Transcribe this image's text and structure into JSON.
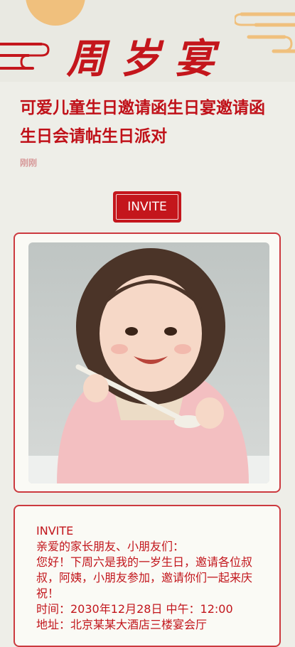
{
  "header": {
    "brand": "周岁宴"
  },
  "article": {
    "title": "可爱儿童生日邀请函生日宴邀请函生日会请帖生日派对",
    "time": "刚刚"
  },
  "badge": {
    "label": "INVITE"
  },
  "invitation": {
    "heading": "INVITE",
    "greeting": "亲爱的家长朋友、小朋友们：",
    "message": "您好！下周六是我的一岁生日，邀请各位叔叔，阿姨，小朋友参加，邀请你们一起来庆祝！",
    "time_line": "时间：2030年12月28日  中午：12:00",
    "address_line": "地址：北京某某大酒店三楼宴会厅"
  },
  "colors": {
    "accent": "#c4161c",
    "gold": "#f0c07d",
    "background": "#eeeee8"
  }
}
